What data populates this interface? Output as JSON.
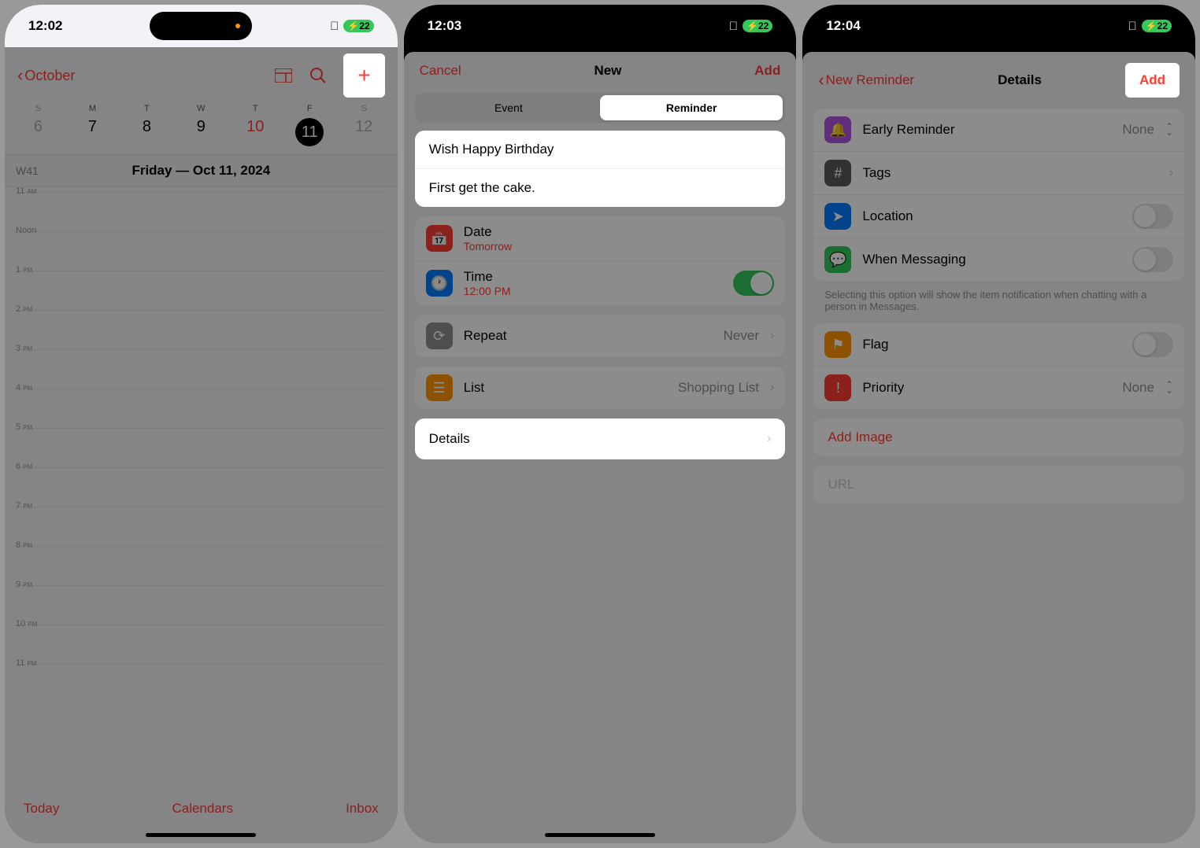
{
  "phone1": {
    "status_time": "12:02",
    "battery": "22",
    "back_label": "October",
    "weekdays": [
      "S",
      "M",
      "T",
      "W",
      "T",
      "F",
      "S"
    ],
    "dates": [
      "6",
      "7",
      "8",
      "9",
      "10",
      "11",
      "12"
    ],
    "week_num": "W41",
    "day_title": "Friday — Oct 11, 2024",
    "hours": [
      "11 AM",
      "Noon",
      "1 PM",
      "2 PM",
      "3 PM",
      "4 PM",
      "5 PM",
      "6 PM",
      "7 PM",
      "8 PM",
      "9 PM",
      "10 PM",
      "11 PM"
    ],
    "bottom": {
      "today": "Today",
      "calendars": "Calendars",
      "inbox": "Inbox"
    }
  },
  "phone2": {
    "status_time": "12:03",
    "battery": "22",
    "cancel": "Cancel",
    "title": "New",
    "add": "Add",
    "seg_event": "Event",
    "seg_reminder": "Reminder",
    "title_input": "Wish Happy Birthday",
    "notes_input": "First get the cake.",
    "date_label": "Date",
    "date_value": "Tomorrow",
    "time_label": "Time",
    "time_value": "12:00 PM",
    "repeat_label": "Repeat",
    "repeat_value": "Never",
    "list_label": "List",
    "list_value": "Shopping List",
    "details_label": "Details"
  },
  "phone3": {
    "status_time": "12:04",
    "battery": "22",
    "back": "New Reminder",
    "title": "Details",
    "add": "Add",
    "early_label": "Early Reminder",
    "early_value": "None",
    "tags_label": "Tags",
    "location_label": "Location",
    "messaging_label": "When Messaging",
    "messaging_footnote": "Selecting this option will show the item notification when chatting with a person in Messages.",
    "flag_label": "Flag",
    "priority_label": "Priority",
    "priority_value": "None",
    "add_image": "Add Image",
    "url_placeholder": "URL"
  }
}
